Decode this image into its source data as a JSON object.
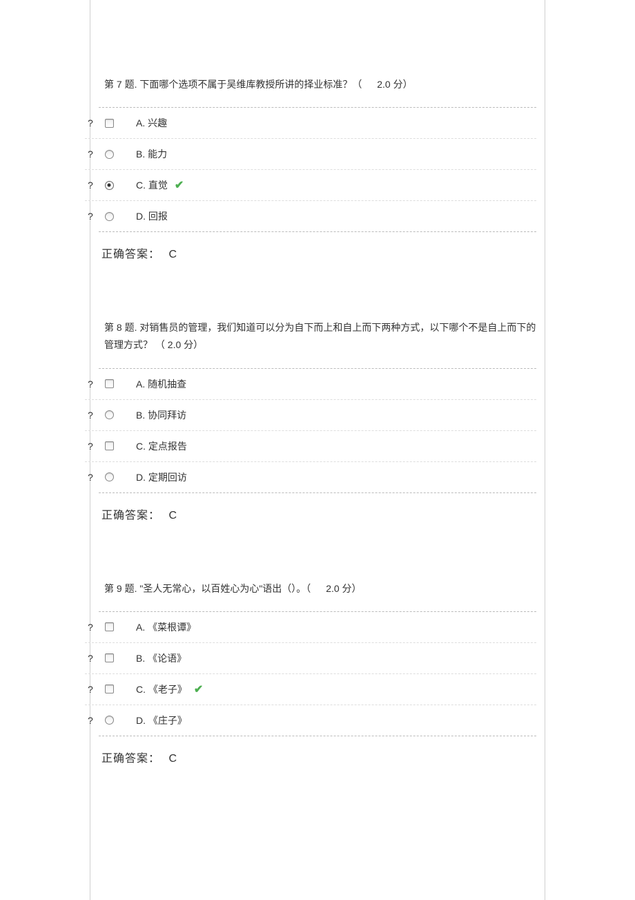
{
  "questions": [
    {
      "number": "第 7 题.",
      "text": "下面哪个选项不属于吴维库教授所讲的择业标准？（",
      "score": "2.0 分）",
      "options": [
        {
          "label": "A. 兴趣",
          "radio": "square",
          "checked": false
        },
        {
          "label": "B. 能力",
          "radio": "circle",
          "checked": false
        },
        {
          "label": "C. 直觉",
          "radio": "checked",
          "checked": true
        },
        {
          "label": "D. 回报",
          "radio": "circle",
          "checked": false
        }
      ],
      "answerLabel": "正确答案：",
      "answer": "C"
    },
    {
      "number": "第 8 题.",
      "text": "对销售员的管理，我们知道可以分为自下而上和自上而下两种方式，以下哪个不是自上而下的管理方式？",
      "score": "（ 2.0 分）",
      "options": [
        {
          "label": "A. 随机抽查",
          "radio": "square",
          "checked": false
        },
        {
          "label": "B. 协同拜访",
          "radio": "circle",
          "checked": false
        },
        {
          "label": "C. 定点报告",
          "radio": "square",
          "checked": false
        },
        {
          "label": "D. 定期回访",
          "radio": "circle",
          "checked": false
        }
      ],
      "answerLabel": "正确答案：",
      "answer": "C"
    },
    {
      "number": "第 9 题.",
      "text": "\"圣人无常心，以百姓心为心\"语出（）。（",
      "score": "2.0 分）",
      "options": [
        {
          "label": "A. 《菜根谭》",
          "radio": "square",
          "checked": false
        },
        {
          "label": "B. 《论语》",
          "radio": "square",
          "checked": false
        },
        {
          "label": "C. 《老子》",
          "radio": "square",
          "checked": true
        },
        {
          "label": "D. 《庄子》",
          "radio": "circle",
          "checked": false
        }
      ],
      "answerLabel": "正确答案：",
      "answer": "C"
    }
  ],
  "qmark": "?"
}
